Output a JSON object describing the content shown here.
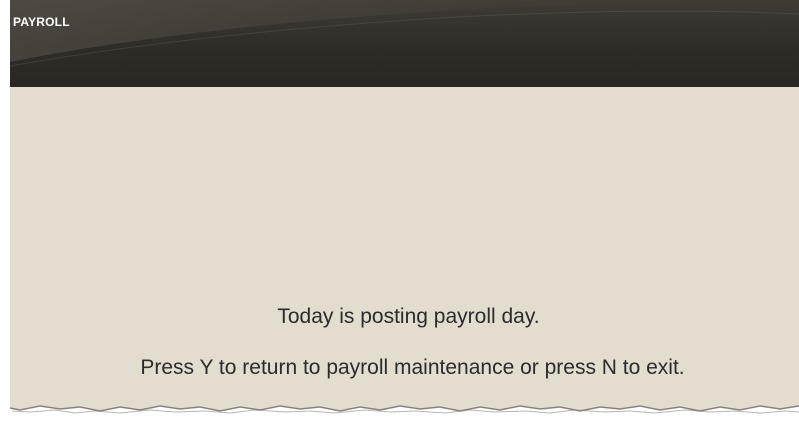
{
  "window": {
    "title": "PAYROLL"
  },
  "message": {
    "line1": "Today is posting payroll day.",
    "line2": "Press Y to return to payroll maintenance or press N to exit."
  },
  "colors": {
    "header_dark": "#2f2b26",
    "background": "#e3ddcf",
    "text": "#2b2b2b"
  }
}
